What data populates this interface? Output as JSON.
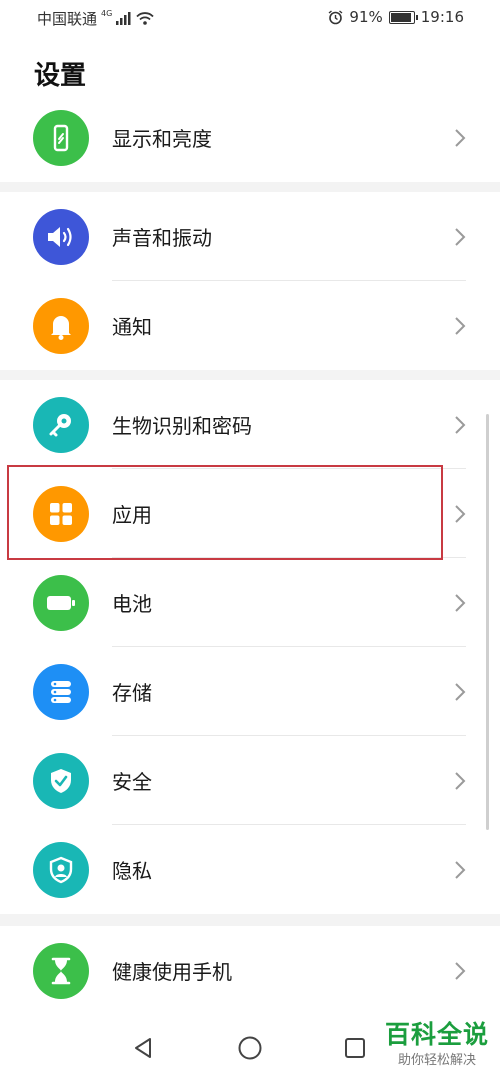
{
  "status_bar": {
    "carrier": "中国联通",
    "network": "4G",
    "battery_percent": "91%",
    "time": "19:16",
    "battery_level": 0.91
  },
  "header": {
    "title": "设置"
  },
  "settings": {
    "group1": [
      {
        "label": "显示和亮度",
        "icon": "display-phone-icon",
        "color": "#3cbf4a"
      }
    ],
    "group2": [
      {
        "label": "声音和振动",
        "icon": "speaker-icon",
        "color": "#3e56d8"
      },
      {
        "label": "通知",
        "icon": "bell-icon",
        "color": "#ff9800"
      }
    ],
    "group3": [
      {
        "label": "生物识别和密码",
        "icon": "key-icon",
        "color": "#19b7b5"
      },
      {
        "label": "应用",
        "icon": "apps-grid-icon",
        "color": "#ff9800"
      },
      {
        "label": "电池",
        "icon": "battery-icon",
        "color": "#3cbf4a"
      },
      {
        "label": "存储",
        "icon": "storage-icon",
        "color": "#1e8ff5"
      },
      {
        "label": "安全",
        "icon": "shield-check-icon",
        "color": "#19b7b5"
      },
      {
        "label": "隐私",
        "icon": "privacy-icon",
        "color": "#19b7b5"
      }
    ],
    "group4": [
      {
        "label": "健康使用手机",
        "icon": "hourglass-icon",
        "color": "#3cbf4a"
      }
    ]
  },
  "watermark": {
    "title": "百科全说",
    "subtitle": "助你轻松解决"
  }
}
